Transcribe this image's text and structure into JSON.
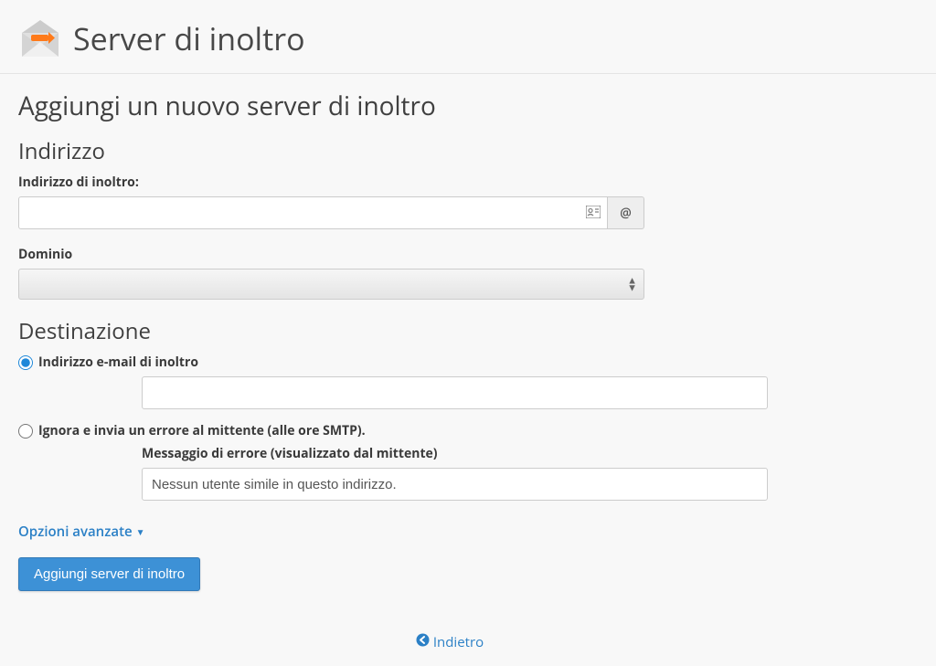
{
  "header": {
    "title": "Server di inoltro"
  },
  "page": {
    "heading": "Aggiungi un nuovo server di inoltro"
  },
  "address_section": {
    "heading": "Indirizzo",
    "forward_label": "Indirizzo di inoltro:",
    "forward_value": "",
    "at_symbol": "@",
    "domain_label": "Dominio",
    "domain_value": ""
  },
  "destination_section": {
    "heading": "Destinazione",
    "option_forward": {
      "label": "Indirizzo e-mail di inoltro",
      "value": "",
      "checked": true
    },
    "option_error": {
      "label": "Ignora e invia un errore al mittente (alle ore SMTP).",
      "error_msg_label": "Messaggio di errore (visualizzato dal mittente)",
      "error_msg_value": "Nessun utente simile in questo indirizzo.",
      "checked": false
    }
  },
  "advanced": {
    "label": "Opzioni avanzate"
  },
  "buttons": {
    "submit": "Aggiungi server di inoltro"
  },
  "footer": {
    "back": "Indietro"
  }
}
